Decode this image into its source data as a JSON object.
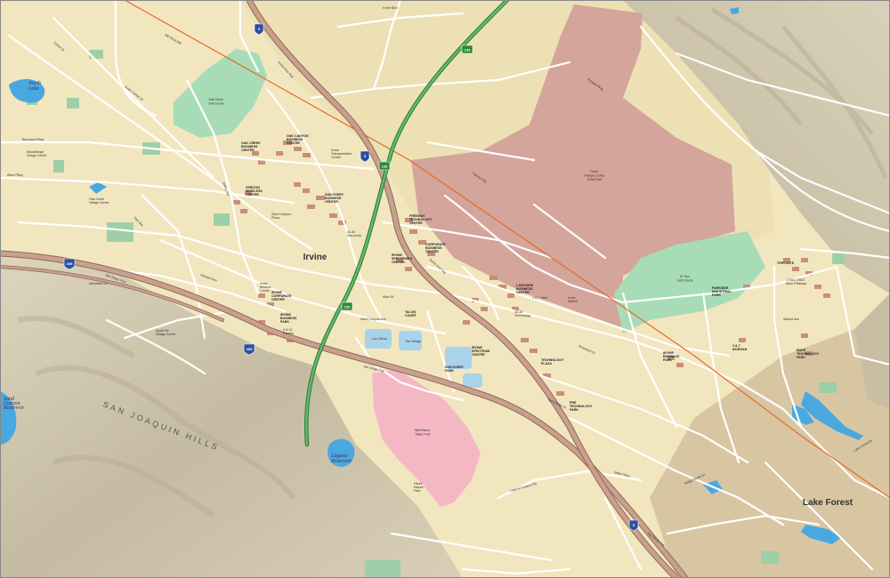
{
  "map": {
    "colors": {
      "land": "#f2e6bf",
      "hills": "#cfc6ad",
      "park": "#a8dcb6",
      "great_park": "#d3a59b",
      "water_park": "#f4b8c4",
      "water": "#4aa8e0",
      "freeway": "#c9a08c",
      "freeway_edge": "#8f6a5a",
      "tollway": "#3f9a4e",
      "rail": "#e56a2a",
      "lake_forest_urban": "#d9c7a6",
      "building": "#c98e79"
    },
    "labels": {
      "city_irvine": "Irvine",
      "city_lake_forest": "Lake Forest",
      "hills": "SAN JOAQUIN HILLS",
      "great_park": [
        "Future",
        "Orange County",
        "Great Park"
      ],
      "wild_rivers": [
        "Wild Rivers",
        "Water Park"
      ],
      "laguna_reservoir": [
        "Laguna",
        "Reservoir"
      ],
      "north_lake": [
        "North",
        "Lake"
      ],
      "sand_canyon_reservoir": [
        "Sand",
        "Canyon",
        "Reservoir"
      ],
      "oak_creek_golf": [
        "Oak Creek",
        "Golf Course"
      ],
      "el_toro_golf": [
        "El Toro",
        "Golf Course"
      ]
    },
    "roads": {
      "san_diego_fwy_1": "San Diego Fwy",
      "san_diego_fwy_2": "San Diego Fwy",
      "san_diego_fwy_3": "San Diego Fwy",
      "santa_ana_fwy_1": "Santa Ana Fwy",
      "santa_ana_fwy_2": "Santa Ana Fwy",
      "metrolink": "METROLINK",
      "barranca": "Barranca Pkwy",
      "alton": "Alton Pkwy",
      "irvine_center": "Irvine Center Dr",
      "jeffrey": "Jeffrey Rd",
      "yale": "Yale Ave",
      "culver": "Culver Dr",
      "harvard": "Harvard Ave",
      "main": "Main St",
      "michelson": "Michelson Dr",
      "walnut": "Walnut Ave",
      "trabuco": "Trabuco Rd",
      "irvine_blvd": "Irvine Blvd",
      "portola": "Portola Pkwy",
      "bake": "Bake Pkwy",
      "lake_forest_dr": "Lake Forest Dr",
      "ridge_route": "Ridge Route Dr",
      "research": "Research Dr",
      "technology": "Technology Dr",
      "laguna_canyon": "Laguna Canyon Rd",
      "sand_canyon": "Sand Canyon Ave"
    },
    "places": {
      "oak_canyon": [
        "OAK CANYON",
        "BUSINESS",
        "CENTER"
      ],
      "oak_creek_bc": [
        "OAK CREEK",
        "BUSINESS",
        "CENTER"
      ],
      "irvine_spectrum": [
        "Irvine",
        "Transportation",
        "Center"
      ],
      "discovery_center": [
        "DISCOVERY",
        "BUSINESS",
        "CENTER"
      ],
      "verizon_center": [
        "VERIZON",
        "WIRELESS",
        "CENTER"
      ],
      "lc_9": [
        "32-40",
        "Discovery"
      ],
      "spectrum_6": [
        "IRVINE",
        "SPECTRUM 6",
        "CENTER"
      ],
      "corporate_bc": [
        "CORPORATE",
        "BUSINESS",
        "CENTER"
      ],
      "freeway_tc": [
        "FREEWAY",
        "TECHNOLOGY",
        "CENTER"
      ],
      "lakeview_bc": [
        "LAKEVIEW",
        "BUSINESS",
        "CENTER"
      ],
      "research_1": [
        "35-38",
        "Technology"
      ],
      "tech_plaza": [
        "TECHNOLOGY",
        "PLAZA"
      ],
      "tech_park": [
        "PRE",
        "TECHNOLOGY",
        "PARK"
      ],
      "palo_center": [
        "TALON",
        "COURT"
      ],
      "rutherford": [
        "1 & 7 Jake"
      ],
      "discovery_2": [
        "DISCOVERY",
        "PARK"
      ],
      "spectrum_center": [
        "IRVINE",
        "SPECTRUM",
        "CENTER"
      ],
      "the_village": [
        "The Village"
      ],
      "los_olivos": [
        "Los Olivos"
      ],
      "children_hosp": [
        "Irvine",
        "Medical",
        "Center"
      ],
      "irvine_corp_center": [
        "IRVINE",
        "CORPORATE",
        "CENTER"
      ],
      "technology_1": [
        "9 & 10",
        "Pasteur"
      ],
      "parkway_bc": [
        "IRVINE",
        "BUSINESS",
        "PARK"
      ],
      "trivista": [
        "TRIPOINTE"
      ],
      "parkside": [
        "PARKSIDE",
        "INDUSTRIAL",
        "PARK"
      ],
      "brc": [
        "3 & 7",
        "MORGAN"
      ],
      "lake_forest_tech": [
        "BAKE",
        "TECHNOLOGY",
        "PARK"
      ],
      "irvine_bp": [
        "IRVINE",
        "BUSINESS",
        "PARK"
      ],
      "alton_pkwy_bp": [
        "17352-17602",
        "Alton Parkway"
      ],
      "hines_park": [
        "Hines",
        "Nature",
        "Park"
      ],
      "jasmine": [
        "Quail Hill",
        "Village Center"
      ],
      "oak_creek_vc": [
        "Oak Creek",
        "Village Center"
      ],
      "woodbridge": [
        "Woodbridge",
        "Village Center"
      ],
      "irvine_station": [
        "Irvine",
        "Station"
      ],
      "canyon_view": [
        "Sand Canyon",
        "Plaza"
      ]
    },
    "shields": {
      "i5_north": "5",
      "i5_south": "5",
      "i5_mid": "5",
      "i405_west": "405",
      "i405_east": "405",
      "sr133_north": "133",
      "sr133_mid": "133",
      "sr133_south": "133",
      "sr241": "241"
    }
  }
}
